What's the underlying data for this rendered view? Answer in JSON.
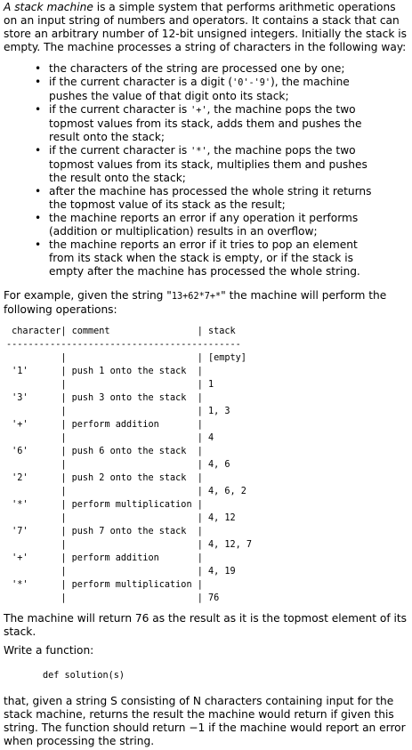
{
  "intro": {
    "term": "A stack machine",
    "rest": " is a simple system that performs arithmetic operations on an input string of numbers and operators. It contains a stack that can store an arbitrary number of 12-bit unsigned integers. Initially the stack is empty. The machine processes a string of characters in the following way:"
  },
  "rules": [
    {
      "parts": [
        {
          "t": "the characters of the string are processed one by one;"
        }
      ]
    },
    {
      "parts": [
        {
          "t": "if the current character is a digit ("
        },
        {
          "c": "'0'-'9'"
        },
        {
          "t": "), the machine pushes the value of that digit onto its stack;"
        }
      ]
    },
    {
      "parts": [
        {
          "t": "if the current character is "
        },
        {
          "c": "'+'"
        },
        {
          "t": ", the machine pops the two topmost values from its stack, adds them and pushes the result onto the stack;"
        }
      ]
    },
    {
      "parts": [
        {
          "t": "if the current character is "
        },
        {
          "c": "'*'"
        },
        {
          "t": ", the machine pops the two topmost values from its stack, multiplies them and pushes the result onto the stack;"
        }
      ]
    },
    {
      "parts": [
        {
          "t": "after the machine has processed the whole string it returns the topmost value of its stack as the result;"
        }
      ]
    },
    {
      "parts": [
        {
          "t": "the machine reports an error if any operation it performs (addition or multiplication) results in an overflow;"
        }
      ]
    },
    {
      "parts": [
        {
          "t": "the machine reports an error if it tries to pop an element from its stack when the stack is empty, or if the stack is empty after the machine has processed the whole string."
        }
      ]
    }
  ],
  "example": {
    "before": "For example, given the string \"",
    "string": "13+62*7+*",
    "after": "\" the machine will perform the following operations:"
  },
  "trace": {
    "header": {
      "character": "character",
      "comment": "comment",
      "stack": "stack"
    },
    "separator": "-------------------------------------------",
    "initial_stack": "[empty]",
    "steps": [
      {
        "character": "'1'",
        "comment": "push 1 onto the stack",
        "stack": "1"
      },
      {
        "character": "'3'",
        "comment": "push 3 onto the stack",
        "stack": "1, 3"
      },
      {
        "character": "'+'",
        "comment": "perform addition",
        "stack": "4"
      },
      {
        "character": "'6'",
        "comment": "push 6 onto the stack",
        "stack": "4, 6"
      },
      {
        "character": "'2'",
        "comment": "push 2 onto the stack",
        "stack": "4, 6, 2"
      },
      {
        "character": "'*'",
        "comment": "perform multiplication",
        "stack": "4, 12"
      },
      {
        "character": "'7'",
        "comment": "push 7 onto the stack",
        "stack": "4, 12, 7"
      },
      {
        "character": "'+'",
        "comment": "perform addition",
        "stack": "4, 19"
      },
      {
        "character": "'*'",
        "comment": "perform multiplication",
        "stack": "76"
      }
    ]
  },
  "result_text": "The machine will return 76 as the result as it is the topmost element of its stack.",
  "write_text": "Write a function:",
  "signature": "def solution(s)",
  "final_text": "that, given a string S consisting of N characters containing input for the stack machine, returns the result the machine would return if given this string. The function should return −1 if the machine would report an error when processing the string."
}
